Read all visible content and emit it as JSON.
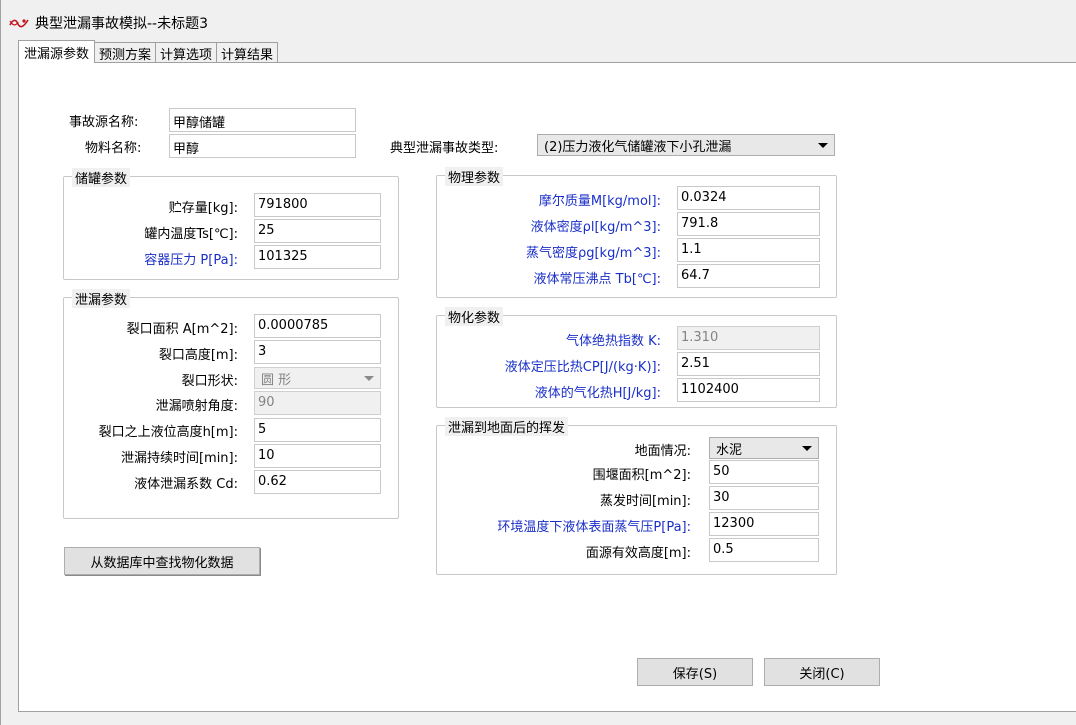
{
  "window": {
    "title": "典型泄漏事故模拟--未标题3"
  },
  "tabs": [
    {
      "label": "泄漏源参数"
    },
    {
      "label": "预测方案"
    },
    {
      "label": "计算选项"
    },
    {
      "label": "计算结果"
    }
  ],
  "top": {
    "source_name_label": "事故源名称:",
    "source_name_value": "甲醇储罐",
    "material_name_label": "物料名称:",
    "material_name_value": "甲醇",
    "accident_type_label": "典型泄漏事故类型:",
    "accident_type_value": "(2)压力液化气储罐液下小孔泄漏"
  },
  "tank_group": {
    "title": "储罐参数",
    "rows": [
      {
        "label": "贮存量[kg]:",
        "value": "791800"
      },
      {
        "label": "罐内温度Ts[℃]:",
        "value": "25"
      },
      {
        "label": "容器压力 P[Pa]:",
        "value": "101325"
      }
    ]
  },
  "leak_group": {
    "title": "泄漏参数",
    "area_label": "裂口面积 A[m^2]:",
    "area_value": "0.0000785",
    "height_label": "裂口高度[m]:",
    "height_value": "3",
    "shape_label": "裂口形状:",
    "shape_value": "圆 形",
    "angle_label": "泄漏喷射角度:",
    "angle_value": "90",
    "level_label": "裂口之上液位高度h[m]:",
    "level_value": "5",
    "duration_label": "泄漏持续时间[min]:",
    "duration_value": "10",
    "coef_label": "液体泄漏系数 Cd:",
    "coef_value": "0.62"
  },
  "phys_group": {
    "title": "物理参数",
    "rows": [
      {
        "label": "摩尔质量M[kg/mol]:",
        "value": "0.0324"
      },
      {
        "label": "液体密度ρl[kg/m^3]:",
        "value": "791.8"
      },
      {
        "label": "蒸气密度ρg[kg/m^3]:",
        "value": "1.1"
      },
      {
        "label": "液体常压沸点 Tb[℃]:",
        "value": "64.7"
      }
    ]
  },
  "chem_group": {
    "title": "物化参数",
    "rows": [
      {
        "label": "气体绝热指数 K:",
        "value": "1.310"
      },
      {
        "label": "液体定压比热CP[J/(kg·K)]:",
        "value": "2.51"
      },
      {
        "label": "液体的气化热H[J/kg]:",
        "value": "1102400"
      }
    ]
  },
  "evap_group": {
    "title": "泄漏到地面后的挥发",
    "ground_label": "地面情况:",
    "ground_value": "水泥",
    "area_label": "围堰面积[m^2]:",
    "area_value": "50",
    "time_label": "蒸发时间[min]:",
    "time_value": "30",
    "vapor_label": "环境温度下液体表面蒸气压P[Pa]:",
    "vapor_value": "12300",
    "source_height_label": "面源有效高度[m]:",
    "source_height_value": "0.5"
  },
  "buttons": {
    "db_lookup": "从数据库中查找物化数据",
    "save": "保存(S)",
    "close": "关闭(C)"
  }
}
